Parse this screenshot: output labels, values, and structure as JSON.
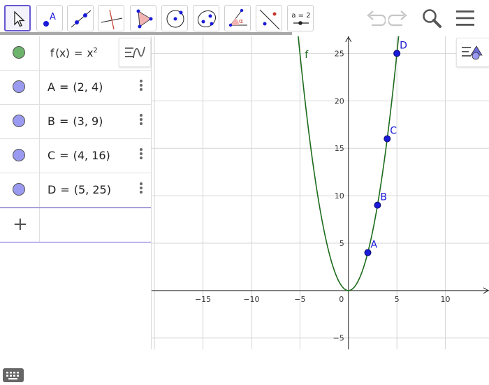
{
  "toolbar": {
    "tools": [
      {
        "name": "move-tool",
        "selected": true
      },
      {
        "name": "point-tool",
        "label": "A"
      },
      {
        "name": "line-tool"
      },
      {
        "name": "perpendicular-line-tool"
      },
      {
        "name": "polygon-tool"
      },
      {
        "name": "circle-center-point-tool"
      },
      {
        "name": "ellipse-tool"
      },
      {
        "name": "angle-tool",
        "label": "α"
      },
      {
        "name": "reflect-tool"
      },
      {
        "name": "slider-tool",
        "label": "a = 2"
      }
    ],
    "undo_icon": "undo-icon",
    "redo_icon": "redo-icon",
    "search_icon": "search-icon",
    "menu_icon": "hamburger-menu-icon"
  },
  "algebra": {
    "function": {
      "name": "f",
      "arg": "(x)",
      "eq": "=",
      "expr_base": "x",
      "expr_exp": "2",
      "marble_color": "#6db36b"
    },
    "points": [
      {
        "name": "A",
        "eq": "=",
        "coords": "(2, 4)",
        "marble_color": "#9a9af0"
      },
      {
        "name": "B",
        "eq": "=",
        "coords": "(3, 9)",
        "marble_color": "#9a9af0"
      },
      {
        "name": "C",
        "eq": "=",
        "coords": "(4, 16)",
        "marble_color": "#9a9af0"
      },
      {
        "name": "D",
        "eq": "=",
        "coords": "(5, 25)",
        "marble_color": "#9a9af0"
      }
    ],
    "add_label": "+"
  },
  "chart_data": {
    "type": "line",
    "title": "",
    "xlabel": "",
    "ylabel": "",
    "xlim": [
      -20.3,
      14.5
    ],
    "ylim": [
      -6.2,
      26.8
    ],
    "x_ticks": [
      -15,
      -10,
      -5,
      0,
      5,
      10
    ],
    "y_ticks": [
      -5,
      5,
      10,
      15,
      20,
      25
    ],
    "grid": true,
    "series": [
      {
        "name": "f",
        "expression": "x^2",
        "color": "#1d6b1d"
      }
    ],
    "points": [
      {
        "name": "A",
        "x": 2,
        "y": 4
      },
      {
        "name": "B",
        "x": 3,
        "y": 9
      },
      {
        "name": "C",
        "x": 4,
        "y": 16
      },
      {
        "name": "D",
        "x": 5,
        "y": 25
      }
    ],
    "point_color": "#1a1ad8"
  }
}
